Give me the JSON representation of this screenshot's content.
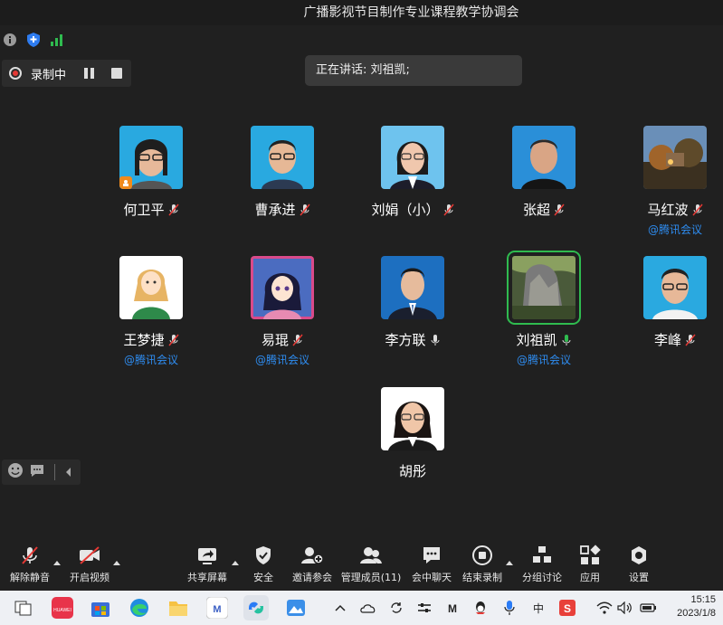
{
  "window": {
    "title": "广播影视节目制作专业课程教学协调会"
  },
  "recording": {
    "label": "录制中"
  },
  "speaking": {
    "text": "正在讲话: 刘祖凯;"
  },
  "participants": [
    {
      "name": "何卫平",
      "sub": "",
      "mic": "muted",
      "host": true
    },
    {
      "name": "曹承进",
      "sub": "",
      "mic": "muted"
    },
    {
      "name": "刘娟（小）",
      "sub": "",
      "mic": "muted-red"
    },
    {
      "name": "张超",
      "sub": "",
      "mic": "muted"
    },
    {
      "name": "马红波",
      "sub": "@腾讯会议",
      "mic": "muted"
    },
    {
      "name": "王梦捷",
      "sub": "@腾讯会议",
      "mic": "muted"
    },
    {
      "name": "易琨",
      "sub": "@腾讯会议",
      "mic": "muted"
    },
    {
      "name": "李方联",
      "sub": "",
      "mic": "on"
    },
    {
      "name": "刘祖凯",
      "sub": "@腾讯会议",
      "mic": "speaking"
    },
    {
      "name": "李峰",
      "sub": "",
      "mic": "muted"
    },
    {
      "name": "胡彤",
      "sub": "",
      "mic": "none"
    }
  ],
  "toolbar": {
    "unmute": "解除静音",
    "video": "开启视频",
    "share": "共享屏幕",
    "security": "安全",
    "invite": "邀请参会",
    "members": "管理成员(11)",
    "chat": "会中聊天",
    "end_record": "结束录制",
    "breakout": "分组讨论",
    "apps": "应用",
    "settings": "设置"
  },
  "taskbar": {
    "time": "15:15",
    "date": "2023/1/8",
    "ime": "中"
  },
  "colors": {
    "accent_blue": "#2e8cf0",
    "speaking_green": "#2fbb4f",
    "rec_red": "#e53935"
  }
}
